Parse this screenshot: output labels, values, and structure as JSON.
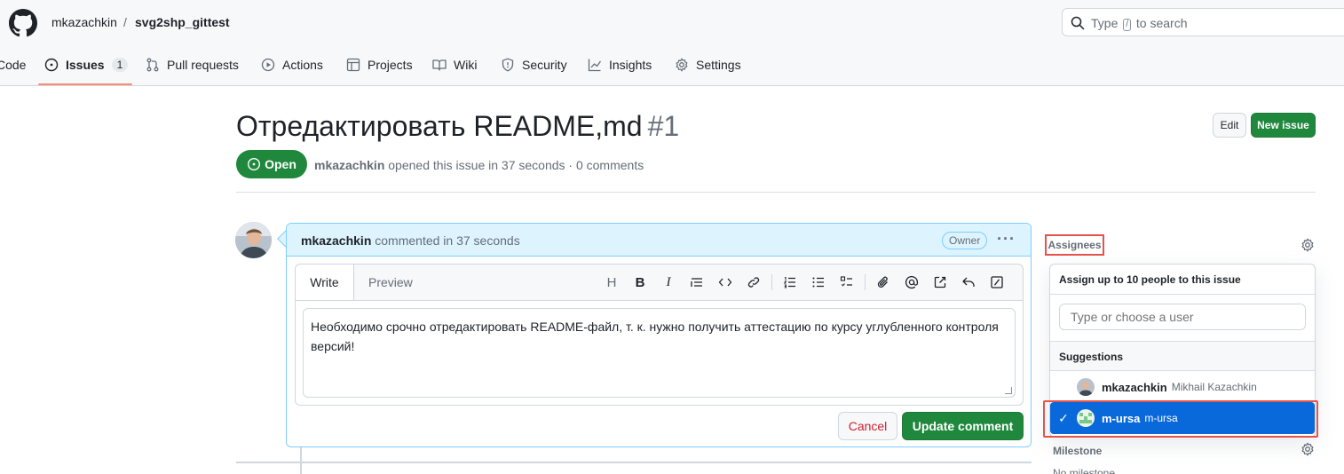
{
  "header": {
    "owner": "mkazachkin",
    "separator": "/",
    "repo": "svg2shp_gittest",
    "search_prefix": "Type",
    "search_key": "/",
    "search_suffix": "to search"
  },
  "nav": {
    "code": "Code",
    "issues": "Issues",
    "issues_count": "1",
    "pull_requests": "Pull requests",
    "actions": "Actions",
    "projects": "Projects",
    "wiki": "Wiki",
    "security": "Security",
    "insights": "Insights",
    "settings": "Settings"
  },
  "issue": {
    "title": "Отредактировать README,md",
    "number": "#1",
    "edit_label": "Edit",
    "new_issue_label": "New issue",
    "state": "Open",
    "author": "mkazachkin",
    "meta": "opened this issue in 37 seconds · 0 comments"
  },
  "comment": {
    "author": "mkazachkin",
    "meta": "commented in 37 seconds",
    "badge": "Owner",
    "menu": "···",
    "tab_write": "Write",
    "tab_preview": "Preview",
    "body": "Необходимо срочно отредактировать README-файл, т. к. нужно получить аттестацию по курсу углубленного контроля версий!",
    "cancel_label": "Cancel",
    "update_label": "Update comment"
  },
  "toolbar": {
    "heading": "H",
    "bold": "B",
    "italic": "I"
  },
  "sidebar": {
    "assignees_label": "Assignees",
    "milestone_label": "Milestone",
    "no_milestone": "No milestone"
  },
  "assignee_dropdown": {
    "header": "Assign up to 10 people to this issue",
    "filter_placeholder": "Type or choose a user",
    "suggestions_label": "Suggestions",
    "users": [
      {
        "login": "mkazachkin",
        "name": "Mikhail Kazachkin",
        "selected": false
      },
      {
        "login": "m-ursa",
        "name": "m-ursa",
        "selected": true
      }
    ],
    "check": "✓"
  },
  "colors": {
    "primary_green": "#1f883d",
    "selected_blue": "#0969da",
    "highlight_red": "#e5534b",
    "nav_underline": "#fd8c73"
  }
}
